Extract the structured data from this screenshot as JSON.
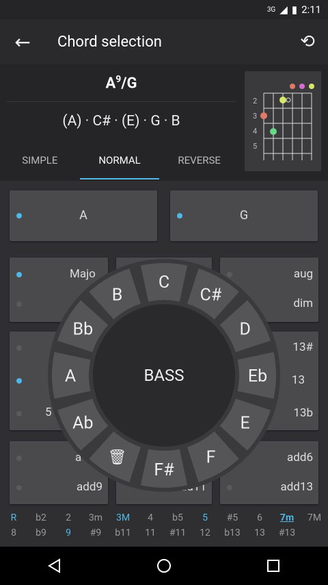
{
  "status": {
    "network": "3G",
    "time": "2:11"
  },
  "appbar": {
    "title": "Chord selection"
  },
  "chord": {
    "root": "A",
    "sup": "9",
    "bass": "/G",
    "notes": "(A) · C# · (E) · G · B"
  },
  "tabs": [
    "SIMPLE",
    "NORMAL",
    "REVERSE"
  ],
  "fret_labels": [
    "2",
    "3",
    "4",
    "5"
  ],
  "cards": {
    "root": "A",
    "bass": "G",
    "major": "Majo",
    "aug": "aug",
    "dim": "dim",
    "thirteen_sharp": "13#",
    "thirteen": "13",
    "thirteen_flat": "13b",
    "five_partial": "5",
    "a_partial": "a",
    "add9": "add9",
    "add11_partial": "add11",
    "add6": "add6",
    "add13": "add13"
  },
  "wheel": {
    "center": "BASS",
    "notes": [
      "C",
      "C#",
      "D",
      "Eb",
      "E",
      "F",
      "F#",
      "delete",
      "Ab",
      "A",
      "Bb",
      "B"
    ]
  },
  "intervals": {
    "top": [
      "R",
      "b2",
      "2",
      "3m",
      "3M",
      "4",
      "b5",
      "5",
      "#5",
      "6",
      "7m",
      "7M"
    ],
    "bottom": [
      "8",
      "b9",
      "9",
      "#9",
      "b11",
      "11",
      "#11",
      "12",
      "b13",
      "13",
      "#13"
    ]
  },
  "colors": {
    "accent": "#4fb8e8",
    "dot_red": "#e07a6a",
    "dot_yellow": "#d7e86a",
    "dot_green": "#6ad88a",
    "dot_pink": "#d86ad0"
  }
}
